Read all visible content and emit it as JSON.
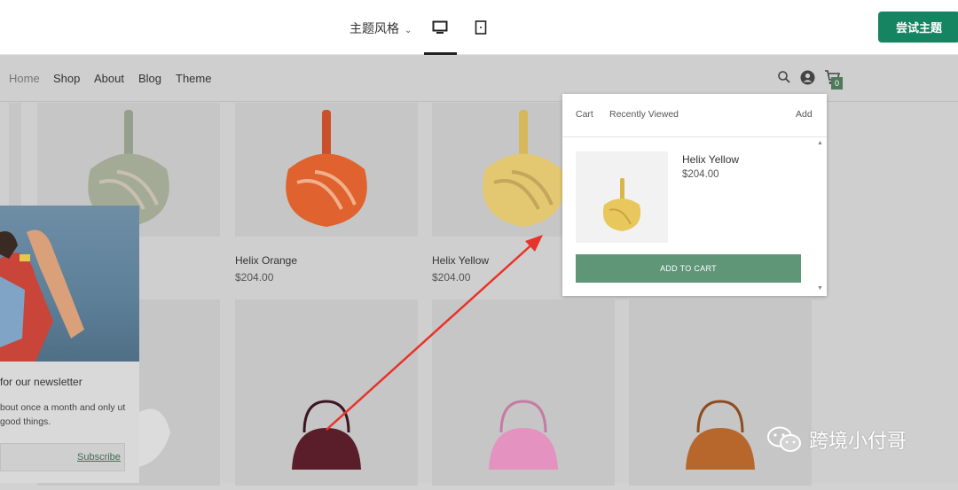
{
  "topbar": {
    "style_label": "主题风格",
    "try_button": "尝试主题"
  },
  "nav": {
    "items": [
      {
        "label": "Home",
        "active": true
      },
      {
        "label": "Shop"
      },
      {
        "label": "About"
      },
      {
        "label": "Blog"
      },
      {
        "label": "Theme"
      }
    ],
    "cart_count": "0"
  },
  "products": [
    {
      "name": "",
      "price": "",
      "color": "#a3ab96"
    },
    {
      "name": "Helix Orange",
      "price": "$204.00",
      "color": "#e0622e"
    },
    {
      "name": "Helix Yellow",
      "price": "$204.00",
      "color": "#e3c871"
    },
    {
      "name": "",
      "price": "",
      "color": "#d7d7d7"
    },
    {
      "name": "",
      "price": "",
      "color": "#5a1e2a"
    },
    {
      "name": "",
      "price": "",
      "color": "#e493c0"
    },
    {
      "name": "",
      "price": "",
      "color": "#b8672c"
    }
  ],
  "newsletter": {
    "title": "for our newsletter",
    "text": "bout once a month and only ut good things.",
    "subscribe": "Subscribe"
  },
  "cart_popup": {
    "tabs": [
      "Cart",
      "Recently Viewed"
    ],
    "add_label": "Add",
    "item": {
      "name": "Helix Yellow",
      "price": "$204.00",
      "color": "#e8c85d"
    },
    "add_to_cart": "ADD TO CART"
  },
  "watermark": {
    "text": "跨境小付哥"
  },
  "annotation": {
    "arrow_color": "#e8332a"
  }
}
